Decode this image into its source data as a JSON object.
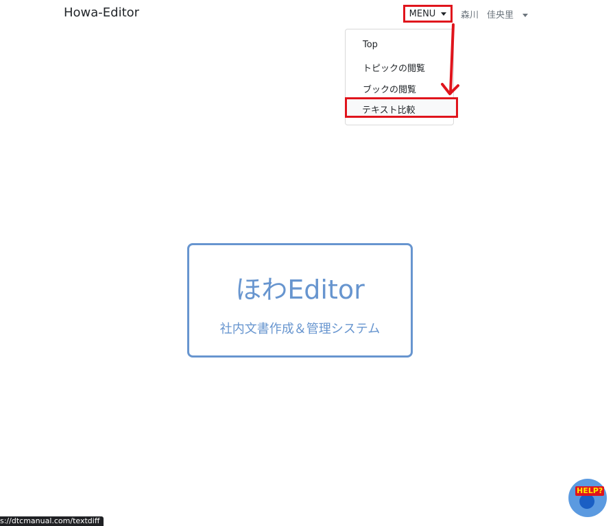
{
  "navbar": {
    "brand": "Howa-Editor",
    "menu_label": "MENU",
    "user_last_name": "森川",
    "user_first_name": "佳央里"
  },
  "dropdown": {
    "items": [
      {
        "label": "Top"
      },
      {
        "label": "トピックの閲覧"
      },
      {
        "label": "ブックの閲覧"
      },
      {
        "label": "テキスト比較"
      }
    ]
  },
  "hero": {
    "title": "ほわEditor",
    "subtitle": "社内文書作成＆管理システム"
  },
  "status_bar": {
    "url": "s://dtcmanual.com/textdiff"
  },
  "help": {
    "label": "HELP?"
  },
  "colors": {
    "accent": "#6795cf",
    "annotation": "#e0141c",
    "help_bg": "#5b9ae0"
  }
}
